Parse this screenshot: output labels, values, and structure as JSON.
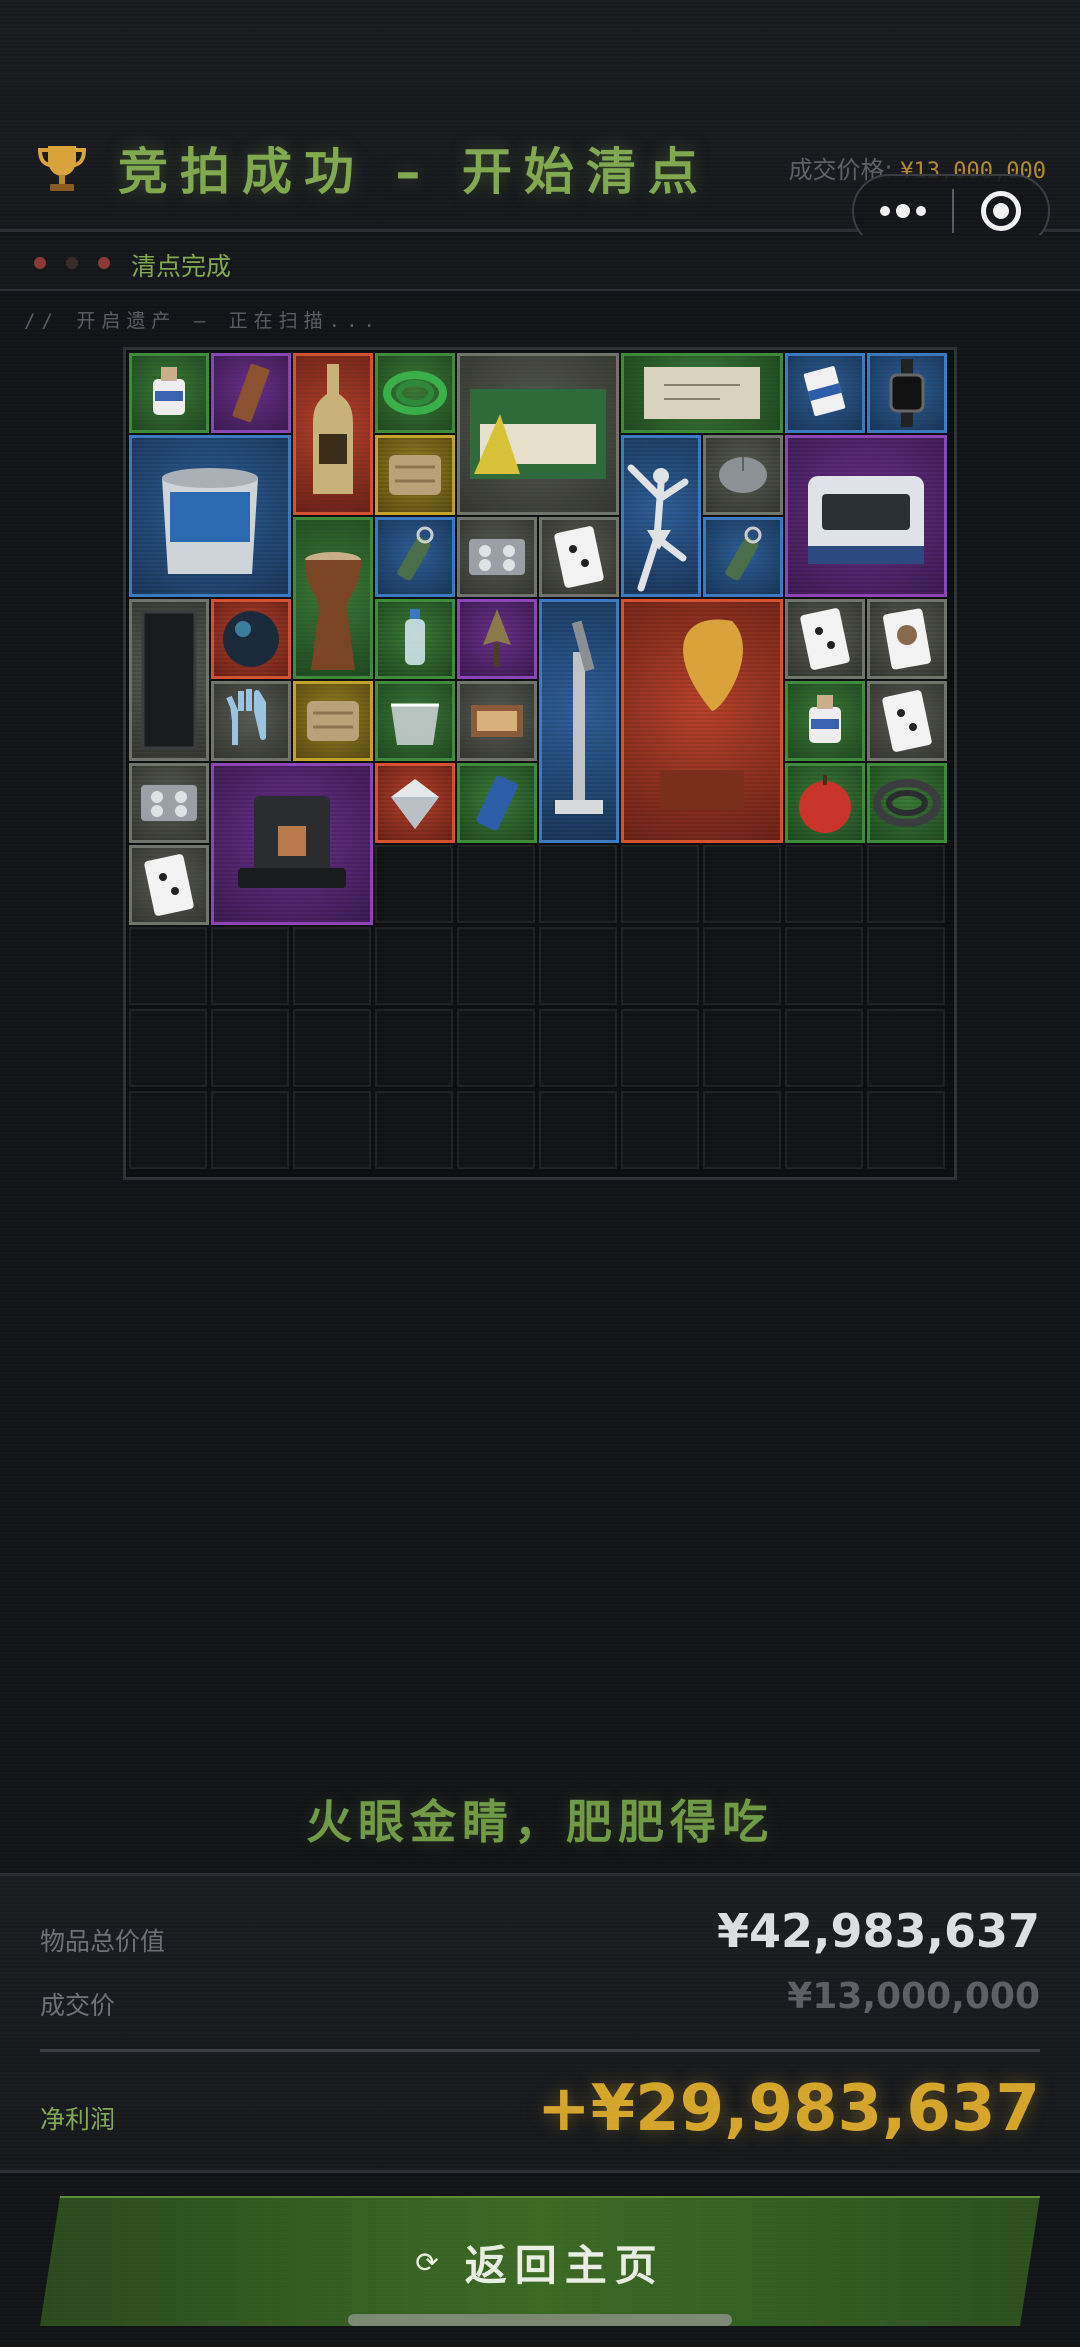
{
  "header": {
    "title": "竞拍成功 – 开始清点",
    "price_label": "成交价格:",
    "price_value": "¥13,000,000"
  },
  "status": {
    "text": "清点完成",
    "dot_colors": [
      "#8a3a34",
      "#3a2a2a",
      "#8a3a34"
    ]
  },
  "scan_text": "// 开启遗产 – 正在扫描...",
  "grid": {
    "cols": 10,
    "rows": 10,
    "items": [
      {
        "name": "glue-bottle",
        "rarity": "green",
        "c": 0,
        "r": 0,
        "w": 1,
        "h": 1
      },
      {
        "name": "chocolate-bar",
        "rarity": "purple",
        "c": 1,
        "r": 0,
        "w": 1,
        "h": 1
      },
      {
        "name": "champagne-bottle",
        "rarity": "red",
        "c": 2,
        "r": 0,
        "w": 1,
        "h": 2
      },
      {
        "name": "green-hose",
        "rarity": "green",
        "c": 3,
        "r": 0,
        "w": 1,
        "h": 1
      },
      {
        "name": "candle-box",
        "rarity": "gray",
        "c": 4,
        "r": 0,
        "w": 2,
        "h": 2
      },
      {
        "name": "old-parchment",
        "rarity": "green",
        "c": 6,
        "r": 0,
        "w": 2,
        "h": 1
      },
      {
        "name": "cigarette-pack",
        "rarity": "blue",
        "c": 8,
        "r": 0,
        "w": 1,
        "h": 1
      },
      {
        "name": "smartwatch",
        "rarity": "blue",
        "c": 9,
        "r": 0,
        "w": 1,
        "h": 1
      },
      {
        "name": "paint-bucket",
        "rarity": "blue",
        "c": 0,
        "r": 1,
        "w": 2,
        "h": 2
      },
      {
        "name": "grain-bag",
        "rarity": "gold",
        "c": 3,
        "r": 1,
        "w": 1,
        "h": 1
      },
      {
        "name": "ballerina-statue",
        "rarity": "blue",
        "c": 6,
        "r": 1,
        "w": 1,
        "h": 2
      },
      {
        "name": "computer-mouse",
        "rarity": "gray",
        "c": 7,
        "r": 1,
        "w": 1,
        "h": 1
      },
      {
        "name": "lab-shaker",
        "rarity": "purple",
        "c": 8,
        "r": 1,
        "w": 2,
        "h": 2
      },
      {
        "name": "djembe-drum",
        "rarity": "green",
        "c": 2,
        "r": 2,
        "w": 1,
        "h": 2
      },
      {
        "name": "flashlight",
        "rarity": "blue",
        "c": 3,
        "r": 2,
        "w": 1,
        "h": 1
      },
      {
        "name": "pill-tray",
        "rarity": "gray",
        "c": 4,
        "r": 2,
        "w": 1,
        "h": 1
      },
      {
        "name": "playing-card",
        "rarity": "gray",
        "c": 5,
        "r": 2,
        "w": 1,
        "h": 1
      },
      {
        "name": "flashlight",
        "rarity": "blue",
        "c": 7,
        "r": 2,
        "w": 1,
        "h": 1
      },
      {
        "name": "black-panel",
        "rarity": "gray",
        "c": 0,
        "r": 3,
        "w": 1,
        "h": 2
      },
      {
        "name": "glass-orb",
        "rarity": "red",
        "c": 1,
        "r": 3,
        "w": 1,
        "h": 1
      },
      {
        "name": "water-bottle",
        "rarity": "green",
        "c": 3,
        "r": 3,
        "w": 1,
        "h": 1
      },
      {
        "name": "spearhead",
        "rarity": "purple",
        "c": 4,
        "r": 3,
        "w": 1,
        "h": 1
      },
      {
        "name": "microscope",
        "rarity": "blue",
        "c": 5,
        "r": 3,
        "w": 1,
        "h": 3
      },
      {
        "name": "gramophone",
        "rarity": "red",
        "c": 6,
        "r": 3,
        "w": 2,
        "h": 3
      },
      {
        "name": "playing-card",
        "rarity": "gray",
        "c": 8,
        "r": 3,
        "w": 1,
        "h": 1
      },
      {
        "name": "portrait-card",
        "rarity": "gray",
        "c": 9,
        "r": 3,
        "w": 1,
        "h": 1
      },
      {
        "name": "rubber-gloves",
        "rarity": "gray",
        "c": 1,
        "r": 4,
        "w": 1,
        "h": 1
      },
      {
        "name": "grain-bag",
        "rarity": "gold",
        "c": 2,
        "r": 4,
        "w": 1,
        "h": 1
      },
      {
        "name": "plastic-bag",
        "rarity": "green",
        "c": 3,
        "r": 4,
        "w": 1,
        "h": 1
      },
      {
        "name": "matchbox",
        "rarity": "gray",
        "c": 4,
        "r": 4,
        "w": 1,
        "h": 1
      },
      {
        "name": "glue-bottle",
        "rarity": "green",
        "c": 8,
        "r": 4,
        "w": 1,
        "h": 1
      },
      {
        "name": "playing-card",
        "rarity": "gray",
        "c": 9,
        "r": 4,
        "w": 1,
        "h": 1
      },
      {
        "name": "pill-tray",
        "rarity": "gray",
        "c": 0,
        "r": 5,
        "w": 1,
        "h": 1
      },
      {
        "name": "coffee-machine",
        "rarity": "purple",
        "c": 1,
        "r": 5,
        "w": 2,
        "h": 2
      },
      {
        "name": "diamond",
        "rarity": "red",
        "c": 3,
        "r": 5,
        "w": 1,
        "h": 1
      },
      {
        "name": "battery-can",
        "rarity": "green",
        "c": 4,
        "r": 5,
        "w": 1,
        "h": 1
      },
      {
        "name": "red-apple",
        "rarity": "green",
        "c": 8,
        "r": 5,
        "w": 1,
        "h": 1
      },
      {
        "name": "coiled-cable",
        "rarity": "green",
        "c": 9,
        "r": 5,
        "w": 1,
        "h": 1
      },
      {
        "name": "playing-card",
        "rarity": "gray",
        "c": 0,
        "r": 6,
        "w": 1,
        "h": 1
      }
    ]
  },
  "slogan": "火眼金睛，肥肥得吃",
  "summary": {
    "total_label": "物品总价值",
    "total_value": "¥42,983,637",
    "deal_label": "成交价",
    "deal_value": "¥13,000,000",
    "profit_label": "净利润",
    "profit_value": "+¥29,983,637"
  },
  "home_button": {
    "label": "返回主页",
    "icon": "⟳"
  },
  "colors": {
    "accent_green": "#7fa84f",
    "gold": "#d4a52a",
    "rarity": {
      "green": "r-green",
      "purple": "r-purple",
      "red": "r-red",
      "blue": "r-blue",
      "gold": "r-gold",
      "gray": "r-gray"
    }
  }
}
